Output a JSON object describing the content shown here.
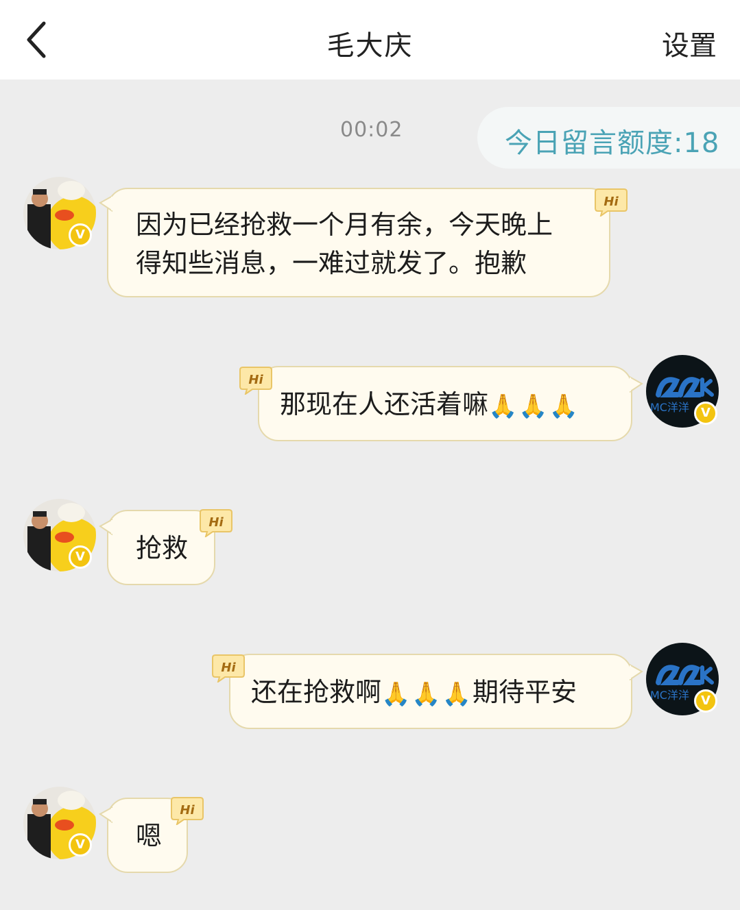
{
  "header": {
    "title": "毛大庆",
    "settings_label": "设置",
    "back_icon": "chevron-left-icon"
  },
  "chat": {
    "timestamp": "00:02",
    "quota": "今日留言额度:18"
  },
  "messages": [
    {
      "side": "left",
      "line1": "因为已经抢救一个月有余，今天晚上",
      "line2": "得知些消息，一难过就发了。抱歉"
    },
    {
      "side": "right",
      "text": "那现在人还活着嘛",
      "emoji": "🙏🙏🙏"
    },
    {
      "side": "left",
      "text": "抢救"
    },
    {
      "side": "right",
      "pre": "还在抢救啊",
      "emoji": "🙏🙏🙏",
      "post": "期待平安"
    },
    {
      "side": "left",
      "text": "嗯"
    }
  ],
  "badge": {
    "label": "V",
    "hi": "Hi"
  },
  "avatar_right": {
    "text": "MC洋洋"
  },
  "colors": {
    "bubble_bg": "#fffbef",
    "bubble_border": "#e5d9ac",
    "quota_text": "#4aa3b5",
    "badge": "#f3c410"
  }
}
